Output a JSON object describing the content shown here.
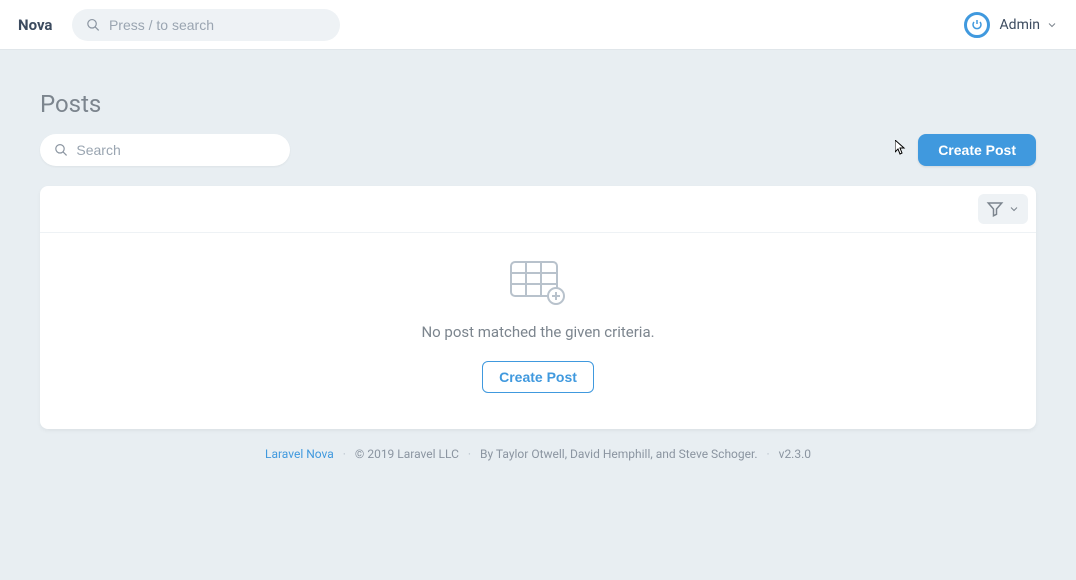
{
  "header": {
    "brand": "Nova",
    "global_search_placeholder": "Press / to search",
    "user_name": "Admin"
  },
  "page": {
    "title": "Posts",
    "search_placeholder": "Search",
    "create_button": "Create Post"
  },
  "empty_state": {
    "message": "No post matched the given criteria.",
    "action": "Create Post"
  },
  "footer": {
    "link": "Laravel Nova",
    "copyright": "© 2019 Laravel LLC",
    "credits": "By Taylor Otwell, David Hemphill, and Steve Schoger.",
    "version": "v2.3.0"
  }
}
